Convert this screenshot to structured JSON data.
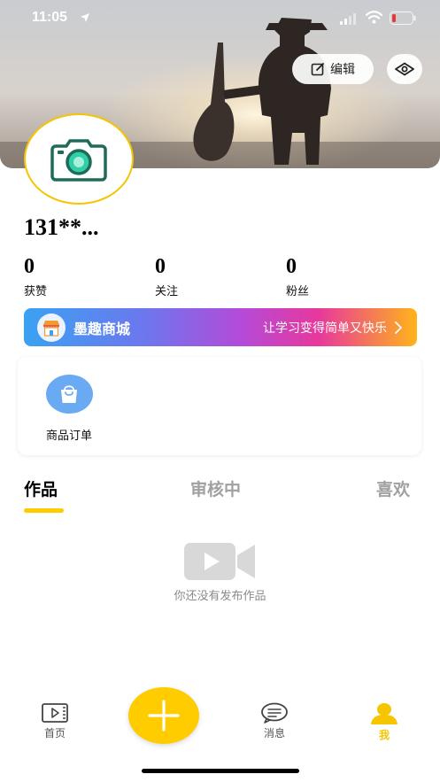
{
  "status_bar": {
    "time": "11:05",
    "icons": [
      "location-arrow-icon",
      "signal-icon",
      "wifi-icon",
      "battery-low-icon"
    ],
    "battery_color": "#e53935"
  },
  "header": {
    "edit_label": "编辑",
    "edit_icon": "edit-icon",
    "visibility_icon": "eye-icon"
  },
  "profile": {
    "username": "131**...",
    "avatar_icon": "camera-icon",
    "stats": [
      {
        "value": "0",
        "label": "获赞"
      },
      {
        "value": "0",
        "label": "关注"
      },
      {
        "value": "0",
        "label": "粉丝"
      }
    ]
  },
  "shop_banner": {
    "title": "墨趣商城",
    "slogan": "让学习变得简单又快乐",
    "icon": "shop-icon"
  },
  "orders": {
    "label": "商品订单",
    "icon": "shopping-bag-icon"
  },
  "tabs": [
    {
      "label": "作品",
      "active": true
    },
    {
      "label": "审核中",
      "active": false
    },
    {
      "label": "喜欢",
      "active": false
    }
  ],
  "empty_state": {
    "text": "你还没有发布作品",
    "icon": "video-camera-icon"
  },
  "bottom_nav": [
    {
      "label": "首页",
      "icon": "video-home-icon"
    },
    {
      "label": "",
      "icon": "plus-icon"
    },
    {
      "label": "消息",
      "icon": "message-icon"
    },
    {
      "label": "我",
      "icon": "user-icon",
      "active": true
    }
  ],
  "colors": {
    "accent": "#ffcc00",
    "avatar_border": "#f5c500",
    "orders_icon_bg": "#6aaaf3",
    "inactive_tab": "#a0a0a0"
  }
}
